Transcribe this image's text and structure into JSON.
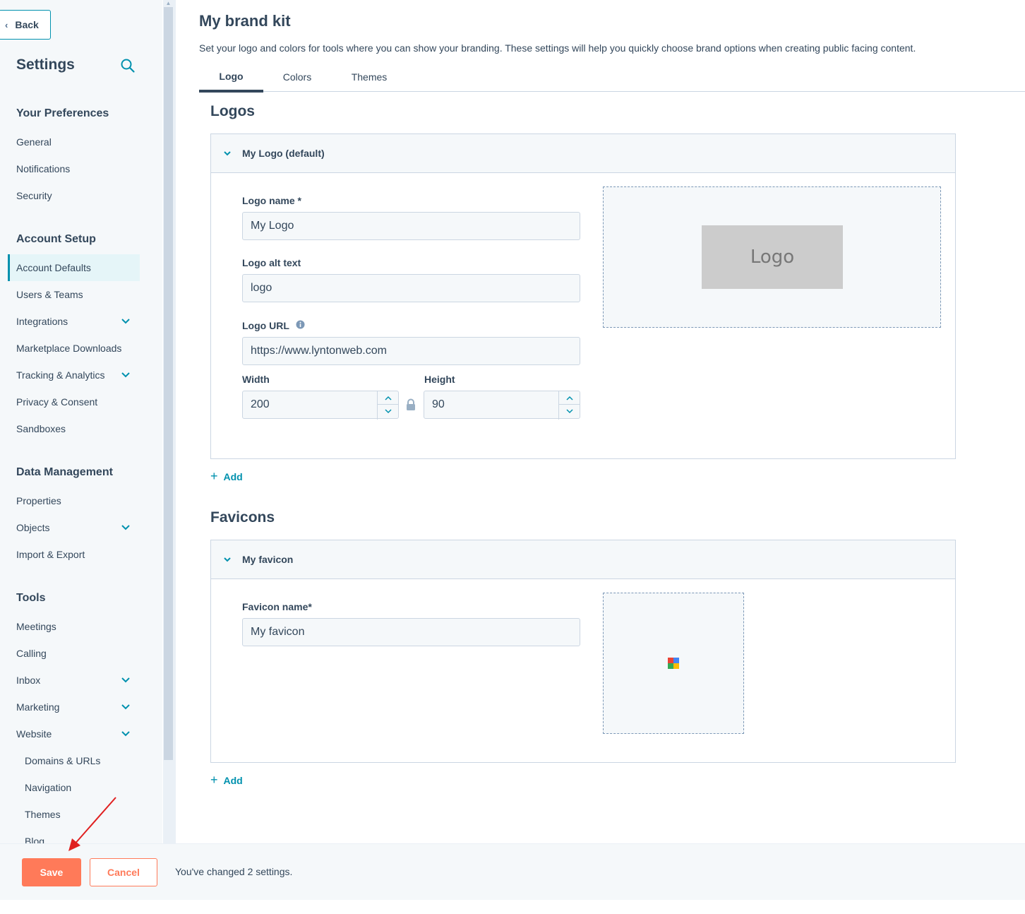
{
  "sidebar": {
    "back_label": "Back",
    "title": "Settings",
    "sections": {
      "preferences": "Your Preferences",
      "account_setup": "Account Setup",
      "data_management": "Data Management",
      "tools": "Tools"
    },
    "items": {
      "general": "General",
      "notifications": "Notifications",
      "security": "Security",
      "account_defaults": "Account Defaults",
      "users_teams": "Users & Teams",
      "integrations": "Integrations",
      "marketplace_downloads": "Marketplace Downloads",
      "tracking_analytics": "Tracking & Analytics",
      "privacy_consent": "Privacy & Consent",
      "sandboxes": "Sandboxes",
      "properties": "Properties",
      "objects": "Objects",
      "import_export": "Import & Export",
      "meetings": "Meetings",
      "calling": "Calling",
      "inbox": "Inbox",
      "marketing": "Marketing",
      "website": "Website",
      "domains_urls": "Domains & URLs",
      "navigation": "Navigation",
      "themes": "Themes",
      "blog": "Blog"
    }
  },
  "main": {
    "title": "My brand kit",
    "description": "Set your logo and colors for tools where you can show your branding. These settings will help you quickly choose brand options when creating public facing content.",
    "tabs": [
      "Logo",
      "Colors",
      "Themes"
    ],
    "logos": {
      "heading": "Logos",
      "panel_title": "My Logo (default)",
      "logo_name_label": "Logo name *",
      "logo_name_value": "My Logo",
      "alt_label": "Logo alt text",
      "alt_value": "logo",
      "url_label": "Logo URL",
      "url_value": "https://www.lyntonweb.com",
      "width_label": "Width",
      "width_value": "200",
      "height_label": "Height",
      "height_value": "90",
      "preview_text": "Logo",
      "add_label": "Add"
    },
    "favicons": {
      "heading": "Favicons",
      "panel_title": "My favicon",
      "name_label": "Favicon name*",
      "name_value": "My favicon",
      "add_label": "Add"
    }
  },
  "footer": {
    "save_label": "Save",
    "cancel_label": "Cancel",
    "message": "You've changed 2 settings."
  },
  "colors": {
    "accent": "#0091ae",
    "primary_action": "#ff7a59",
    "text": "#33475b"
  }
}
